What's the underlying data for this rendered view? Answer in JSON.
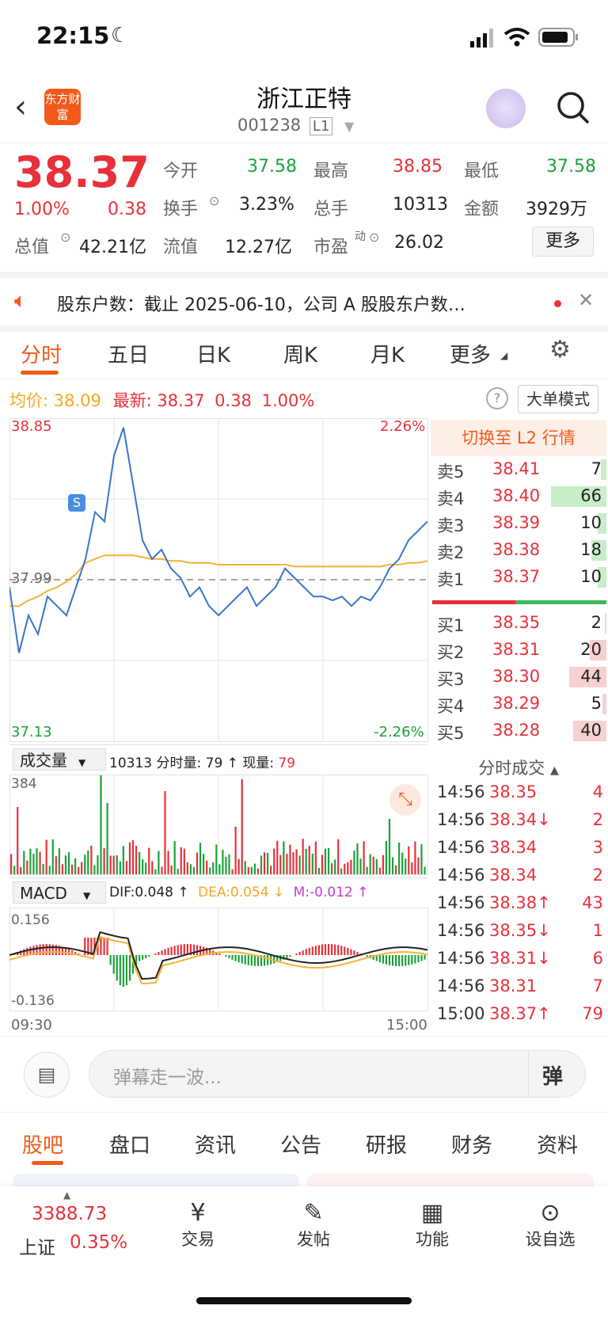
{
  "status_bar": {
    "time": "22:15"
  },
  "header": {
    "title": "浙江正特",
    "code": "001238",
    "level": "L1",
    "logo_text": "东方财富"
  },
  "quote": {
    "price": "38.37",
    "change_pct": "1.00%",
    "change": "0.38",
    "open_label": "今开",
    "open": "37.58",
    "high_label": "最高",
    "high": "38.85",
    "low_label": "最低",
    "low": "37.58",
    "turnover_label": "换手",
    "turnover": "3.23%",
    "volume_label": "总手",
    "volume": "10313",
    "amount_label": "金额",
    "amount": "3929万",
    "mktcap_label": "总值",
    "mktcap": "42.21亿",
    "float_label": "流值",
    "float_cap": "12.27亿",
    "pe_label": "市盈",
    "pe_sup": "动",
    "pe": "26.02",
    "more_button": "更多"
  },
  "news": {
    "text": "股东户数：截止 2025-06-10，公司 A 股股东户数…"
  },
  "tabs": [
    "分时",
    "五日",
    "日K",
    "周K",
    "月K",
    "更多"
  ],
  "chart_header": {
    "avg_label": "均价:",
    "avg": "38.09",
    "last_label": "最新:",
    "last": "38.37",
    "chg": "0.38",
    "pct": "1.00%",
    "mode_button": "大单模式"
  },
  "chart_data": {
    "type": "line",
    "title": "",
    "y_top_label": "38.85",
    "y_mid_label": "37.99",
    "y_bottom_label": "37.13",
    "pct_top_label": "2.26%",
    "pct_bottom_label": "-2.26%",
    "x_start": "09:30",
    "x_end": "15:00",
    "ylim": [
      37.13,
      38.85
    ],
    "prev_close": 37.99,
    "series": [
      {
        "name": "价格",
        "values": [
          37.95,
          37.6,
          37.8,
          37.7,
          37.9,
          37.85,
          37.8,
          37.95,
          38.1,
          38.35,
          38.3,
          38.65,
          38.8,
          38.5,
          38.2,
          38.1,
          38.15,
          38.05,
          38.0,
          37.9,
          37.95,
          37.85,
          37.8,
          37.85,
          37.9,
          37.95,
          37.85,
          37.9,
          37.95,
          38.05,
          38.0,
          37.95,
          37.9,
          37.9,
          37.88,
          37.9,
          37.85,
          37.9,
          37.88,
          37.95,
          38.05,
          38.1,
          38.2,
          38.25,
          38.3
        ]
      },
      {
        "name": "均价",
        "values": [
          37.85,
          37.85,
          37.88,
          37.9,
          37.93,
          37.95,
          37.98,
          38.02,
          38.08,
          38.1,
          38.12,
          38.12,
          38.12,
          38.12,
          38.11,
          38.1,
          38.1,
          38.09,
          38.09,
          38.08,
          38.08,
          38.08,
          38.07,
          38.07,
          38.07,
          38.07,
          38.07,
          38.07,
          38.07,
          38.07,
          38.06,
          38.06,
          38.06,
          38.06,
          38.06,
          38.06,
          38.06,
          38.06,
          38.06,
          38.06,
          38.07,
          38.07,
          38.08,
          38.08,
          38.09
        ]
      }
    ],
    "volume_max_label": "384",
    "macd_top_label": "0.156",
    "macd_bottom_label": "-0.136"
  },
  "volume_header": {
    "selector": "成交量",
    "total": "10313",
    "tick_label": "分时量:",
    "tick": "79",
    "now_label": "现量:",
    "now": "79"
  },
  "macd_header": {
    "selector": "MACD",
    "dif": "DIF:0.048 ↑",
    "dea": "DEA:0.054 ↓",
    "m": "M:-0.012 ↑"
  },
  "order_book": {
    "switch_label": "切换至 L2 行情",
    "asks": [
      {
        "label": "卖5",
        "price": "38.41",
        "qty": "7"
      },
      {
        "label": "卖4",
        "price": "38.40",
        "qty": "66"
      },
      {
        "label": "卖3",
        "price": "38.39",
        "qty": "10"
      },
      {
        "label": "卖2",
        "price": "38.38",
        "qty": "18"
      },
      {
        "label": "卖1",
        "price": "38.37",
        "qty": "10"
      }
    ],
    "bids": [
      {
        "label": "买1",
        "price": "38.35",
        "qty": "2"
      },
      {
        "label": "买2",
        "price": "38.31",
        "qty": "20"
      },
      {
        "label": "买3",
        "price": "38.30",
        "qty": "44"
      },
      {
        "label": "买4",
        "price": "38.29",
        "qty": "5"
      },
      {
        "label": "买5",
        "price": "38.28",
        "qty": "40"
      }
    ]
  },
  "ticks": {
    "title": "分时成交",
    "rows": [
      {
        "t": "14:56",
        "p": "38.35",
        "q": "4",
        "arrow": ""
      },
      {
        "t": "14:56",
        "p": "38.34↓",
        "q": "2",
        "arrow": "down"
      },
      {
        "t": "14:56",
        "p": "38.34",
        "q": "3",
        "arrow": ""
      },
      {
        "t": "14:56",
        "p": "38.34",
        "q": "2",
        "arrow": ""
      },
      {
        "t": "14:56",
        "p": "38.38↑",
        "q": "43",
        "arrow": "up"
      },
      {
        "t": "14:56",
        "p": "38.35↓",
        "q": "1",
        "arrow": "down"
      },
      {
        "t": "14:56",
        "p": "38.31↓",
        "q": "6",
        "arrow": "down"
      },
      {
        "t": "14:56",
        "p": "38.31",
        "q": "7",
        "arrow": ""
      },
      {
        "t": "15:00",
        "p": "38.37↑",
        "q": "79",
        "arrow": "up"
      }
    ]
  },
  "comment_bar": {
    "placeholder": "弹幕走一波...",
    "danmu": "弹"
  },
  "bottom_tabs": [
    "股吧",
    "盘口",
    "资讯",
    "公告",
    "研报",
    "财务",
    "资料"
  ],
  "footer": {
    "index_value": "3388.73",
    "index_name": "上证",
    "index_pct": "0.35%",
    "trade": "交易",
    "post": "发帖",
    "func": "功能",
    "watch": "设自选"
  }
}
